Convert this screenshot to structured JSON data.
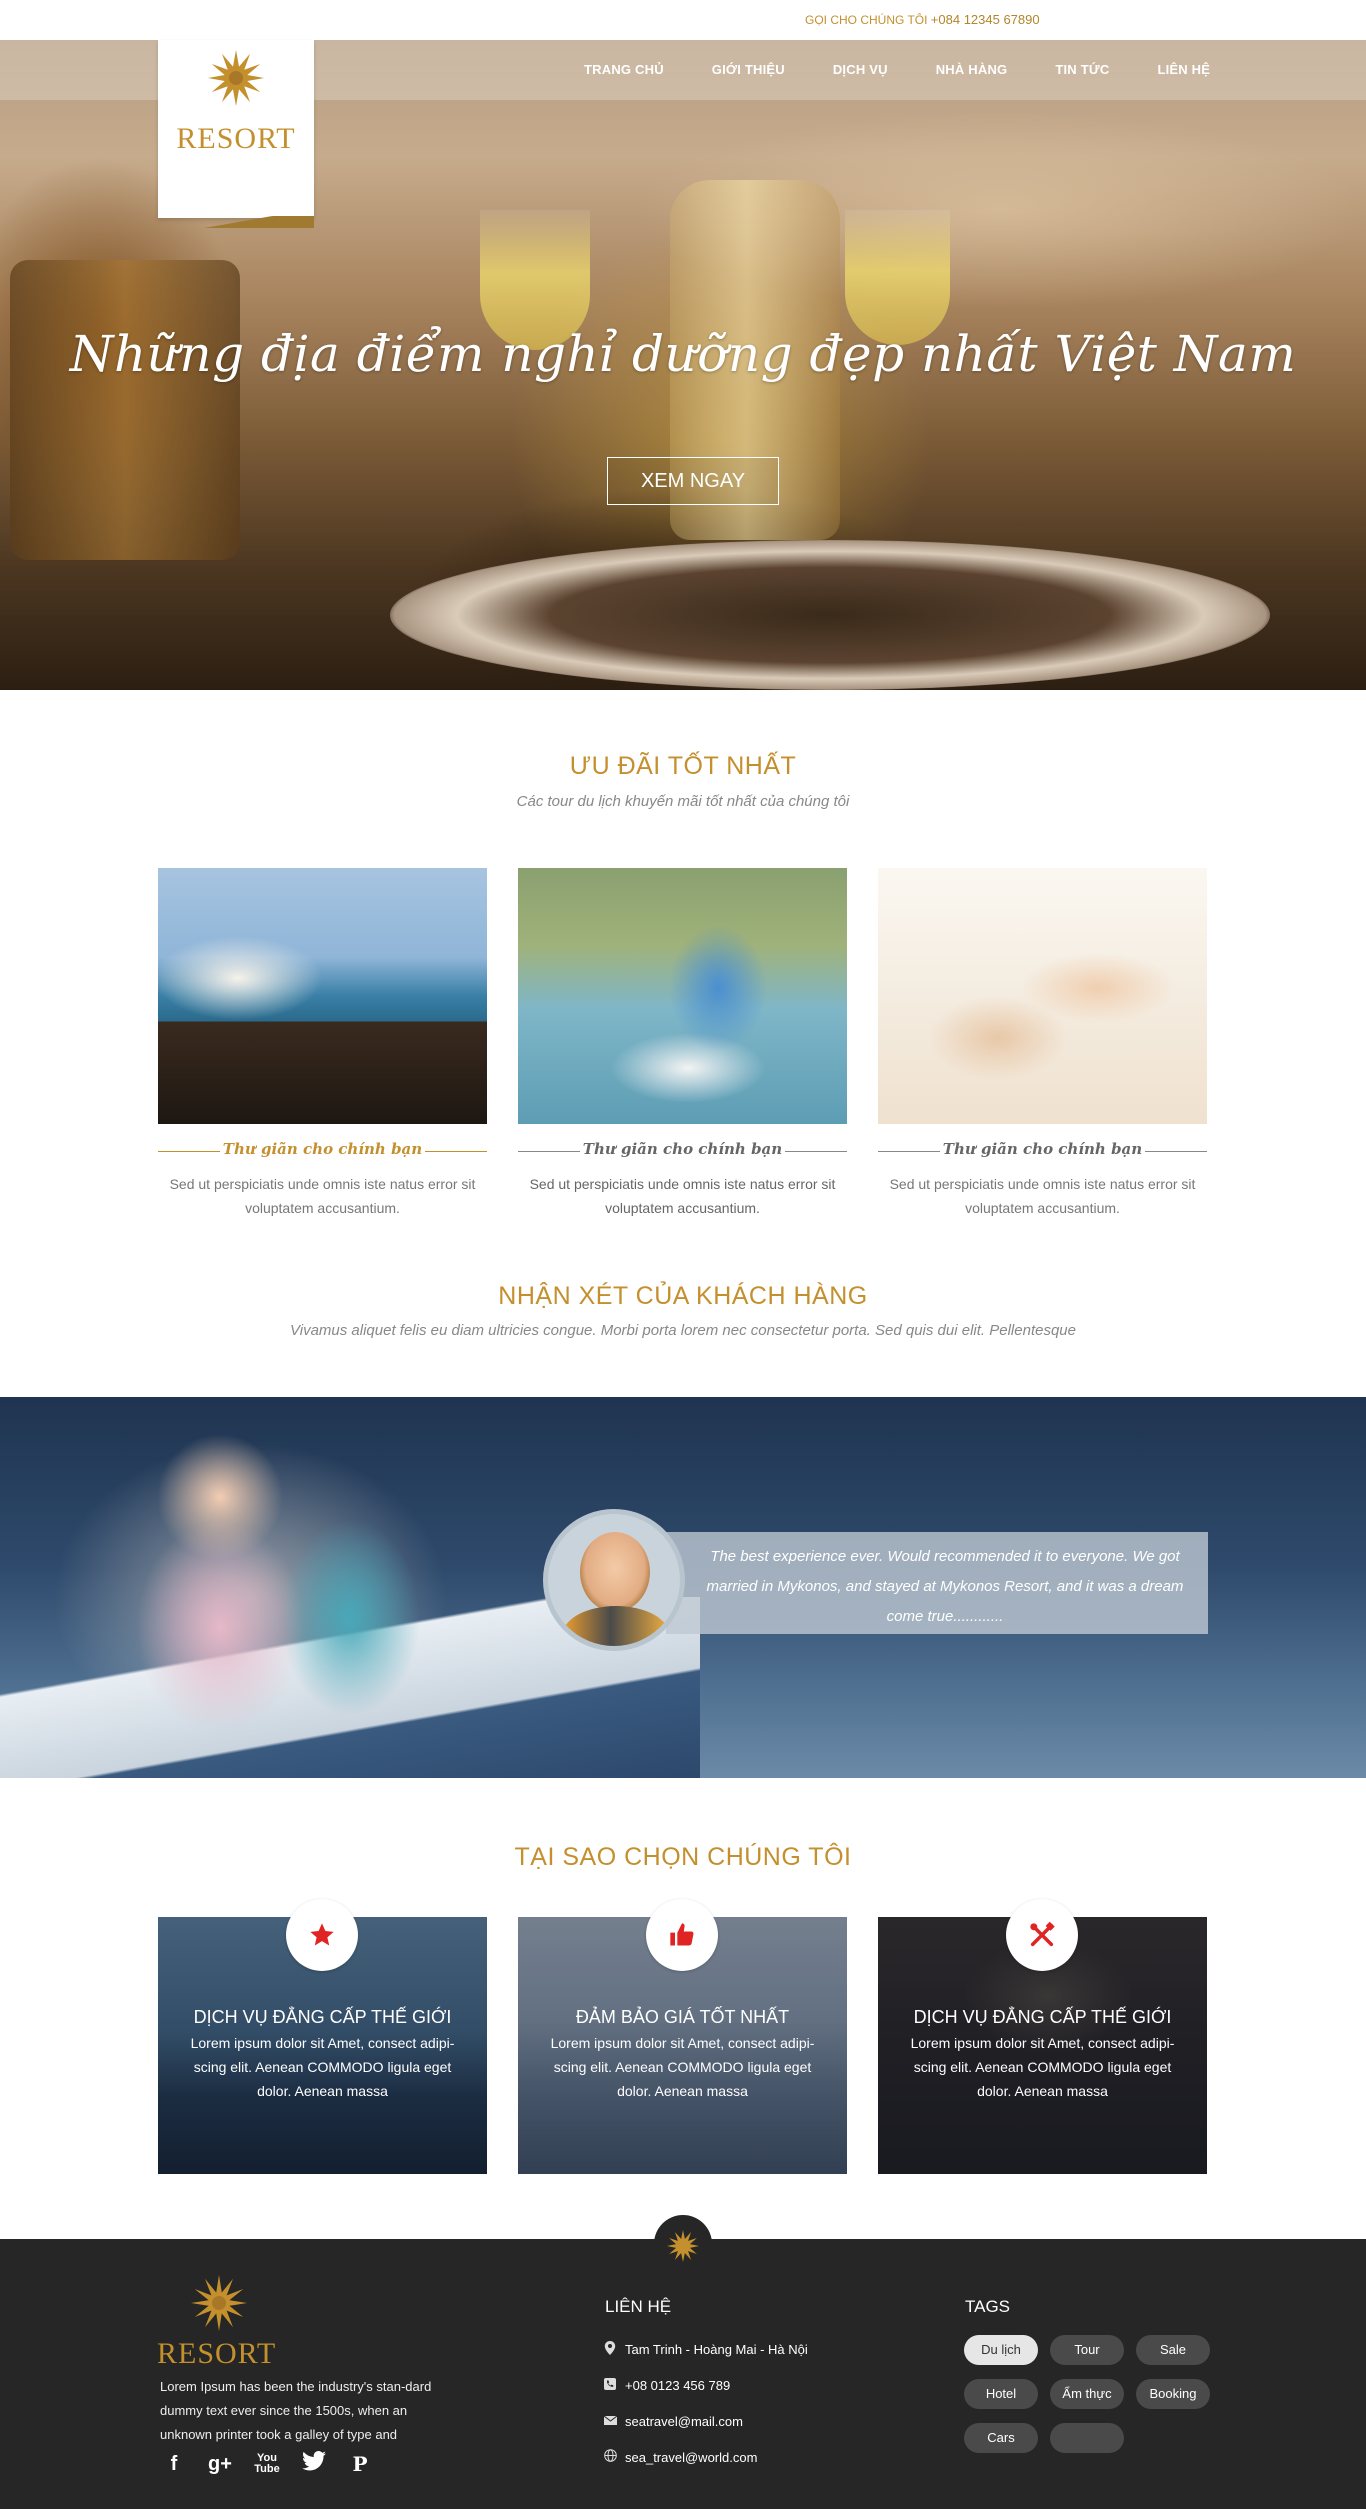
{
  "topbar": {
    "call_label": "GỌI CHO CHÚNG TÔI",
    "phone": "+084 12345 67890"
  },
  "nav": [
    "TRANG CHỦ",
    "GIỚI THIỆU",
    "DỊCH VỤ",
    "NHÀ HÀNG",
    "TIN TỨC",
    "LIÊN HỆ"
  ],
  "logo": {
    "text": "RESORT"
  },
  "hero": {
    "title": "Những địa điểm nghỉ dưỡng đẹp nhất Việt Nam",
    "button": "XEM NGAY"
  },
  "offers": {
    "title": "ƯU ĐÃI TỐT NHẤT",
    "subtitle": "Các tour du lịch khuyến mãi tốt nhất của chúng tôi",
    "items": [
      {
        "caption": "Thư giãn cho chính bạn",
        "desc": "Sed ut perspiciatis unde omnis iste natus error sit voluptatem accusantium."
      },
      {
        "caption": "Thư giãn cho chính bạn",
        "desc": "Sed ut perspiciatis unde omnis iste natus error sit voluptatem accusantium."
      },
      {
        "caption": "Thư giãn cho chính bạn",
        "desc": "Sed ut perspiciatis unde omnis iste natus error sit voluptatem accusantium."
      }
    ]
  },
  "reviews": {
    "title": "NHẬN XÉT CỦA KHÁCH HÀNG",
    "subtitle": "Vivamus aliquet felis eu diam ultricies congue. Morbi porta lorem nec consectetur porta. Sed quis dui elit. Pellentesque",
    "quote": "The best experience ever. Would recommended it to everyone. We got married in Mykonos, and stayed at Mykonos Resort, and it was a dream come true............"
  },
  "why": {
    "title": "TẠI SAO CHỌN CHÚNG TÔI",
    "items": [
      {
        "icon": "star-icon",
        "heading": "DỊCH VỤ ĐẲNG CẤP THẾ GIỚI",
        "text": "Lorem ipsum dolor sit Amet, consect adipi-scing elit. Aenean COMMODO ligula eget dolor. Aenean massa"
      },
      {
        "icon": "thumbs-up-icon",
        "heading": "ĐẢM BẢO GIÁ TỐT NHẤT",
        "text": "Lorem ipsum dolor sit Amet, consect adipi-scing elit. Aenean COMMODO ligula eget dolor. Aenean massa"
      },
      {
        "icon": "tools-icon",
        "heading": "DỊCH VỤ ĐẲNG CẤP THẾ GIỚI",
        "text": "Lorem ipsum dolor sit Amet, consect adipi-scing elit. Aenean COMMODO ligula eget dolor. Aenean massa"
      }
    ]
  },
  "footer": {
    "logo": "RESORT",
    "about": "Lorem Ipsum has been the industry's stan-dard dummy text ever since the 1500s, when an unknown printer took a galley of type and",
    "social": [
      "f",
      "g+",
      "You Tube",
      "twitter",
      "P"
    ],
    "contact_title": "LIÊN HỆ",
    "address": "Tam Trinh - Hoàng Mai - Hà Nội",
    "phone": "+08 0123 456 789",
    "email": "seatravel@mail.com",
    "website": "sea_travel@world.com",
    "tags_title": "TAGS",
    "tags": [
      "Du lịch",
      "Tour",
      "Sale",
      "Hotel",
      "Ẩm thực",
      "Booking",
      "Cars",
      ""
    ]
  },
  "colors": {
    "accent": "#c4902e",
    "footer_bg": "#262626",
    "icon_red": "#e02424"
  }
}
